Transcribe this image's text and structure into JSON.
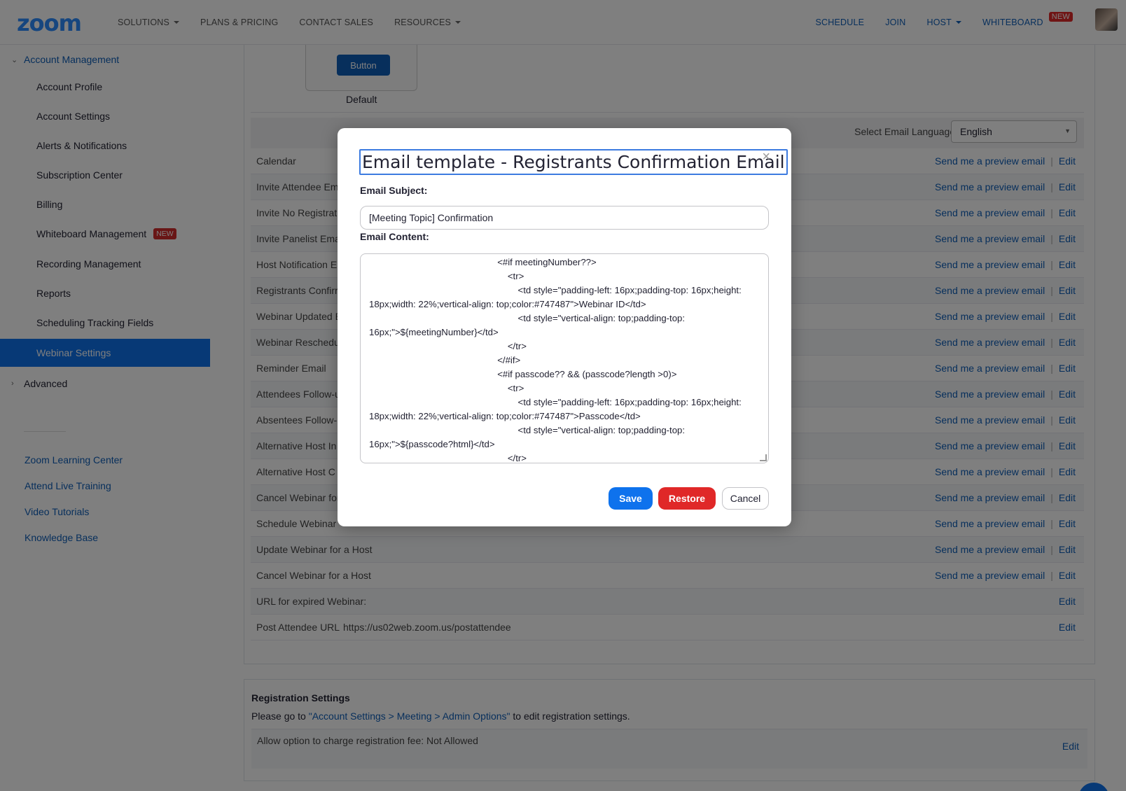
{
  "nav": {
    "logo": "zoom",
    "left": [
      "SOLUTIONS",
      "PLANS & PRICING",
      "CONTACT SALES",
      "RESOURCES"
    ],
    "right": [
      "SCHEDULE",
      "JOIN",
      "HOST",
      "WHITEBOARD"
    ],
    "new_badge": "NEW"
  },
  "sidebar": {
    "section": "Account Management",
    "items": [
      {
        "label": "Account Profile"
      },
      {
        "label": "Account Settings"
      },
      {
        "label": "Alerts & Notifications"
      },
      {
        "label": "Subscription Center"
      },
      {
        "label": "Billing"
      },
      {
        "label": "Whiteboard Management",
        "badge": "NEW"
      },
      {
        "label": "Recording Management"
      },
      {
        "label": "Reports"
      },
      {
        "label": "Scheduling Tracking Fields"
      },
      {
        "label": "Webinar Settings",
        "active": true
      }
    ],
    "advanced": "Advanced",
    "links": [
      "Zoom Learning Center",
      "Attend Live Training",
      "Video Tutorials",
      "Knowledge Base"
    ]
  },
  "main": {
    "button_preview": "Button",
    "default_label": "Default",
    "language_label": "Select Email Language:",
    "language_value": "English",
    "preview_link": "Send me a preview email",
    "edit_link": "Edit",
    "rows": [
      {
        "name": "Calendar"
      },
      {
        "name": "Invite Attendee Em"
      },
      {
        "name": "Invite No Registrat"
      },
      {
        "name": "Invite Panelist Ema"
      },
      {
        "name": "Host Notification E"
      },
      {
        "name": "Registrants Confirr"
      },
      {
        "name": "Webinar Updated E"
      },
      {
        "name": "Webinar Reschedu"
      },
      {
        "name": "Reminder Email"
      },
      {
        "name": "Attendees Follow-u"
      },
      {
        "name": "Absentees Follow-u"
      },
      {
        "name": "Alternative Host In"
      },
      {
        "name": "Alternative Host C"
      },
      {
        "name": "Cancel Webinar for"
      },
      {
        "name": "Schedule Webinar"
      },
      {
        "name": "Update Webinar for a Host"
      },
      {
        "name": "Cancel Webinar for a Host"
      },
      {
        "name": "URL for expired Webinar:",
        "edit_only": true
      },
      {
        "name": "Post Attendee URL",
        "value": "https://us02web.zoom.us/postattendee",
        "edit_only": true
      }
    ],
    "registration": {
      "title": "Registration Settings",
      "text_before": "Please go to ",
      "text_link": "\"Account Settings > Meeting > Admin Options\"",
      "text_after": " to edit registration settings.",
      "fee_row": "Allow option to charge registration fee: Not Allowed",
      "edit": "Edit"
    }
  },
  "modal": {
    "title": "Email template - Registrants Confirmation Email",
    "close": "×",
    "subject_label": "Email Subject:",
    "subject_value": "[Meeting Topic] Confirmation",
    "content_label": "Email Content:",
    "content_value": "                                                  <#if meetingNumber??>\n                                                      <tr>\n                                                          <td style=\"padding-left: 16px;padding-top: 16px;height: 18px;width: 22%;vertical-align: top;color:#747487\">Webinar ID</td>\n                                                          <td style=\"vertical-align: top;padding-top: 16px;\">${meetingNumber}</td>\n                                                      </tr>\n                                                  </#if>\n                                                  <#if passcode?? && (passcode?length >0)>\n                                                      <tr>\n                                                          <td style=\"padding-left: 16px;padding-top: 16px;height: 18px;width: 22%;vertical-align: top;color:#747487\">Passcode</td>\n                                                          <td style=\"vertical-align: top;padding-top: 16px;\">${passcode?html}</td>\n                                                      </tr>",
    "save": "Save",
    "restore": "Restore",
    "cancel": "Cancel"
  }
}
